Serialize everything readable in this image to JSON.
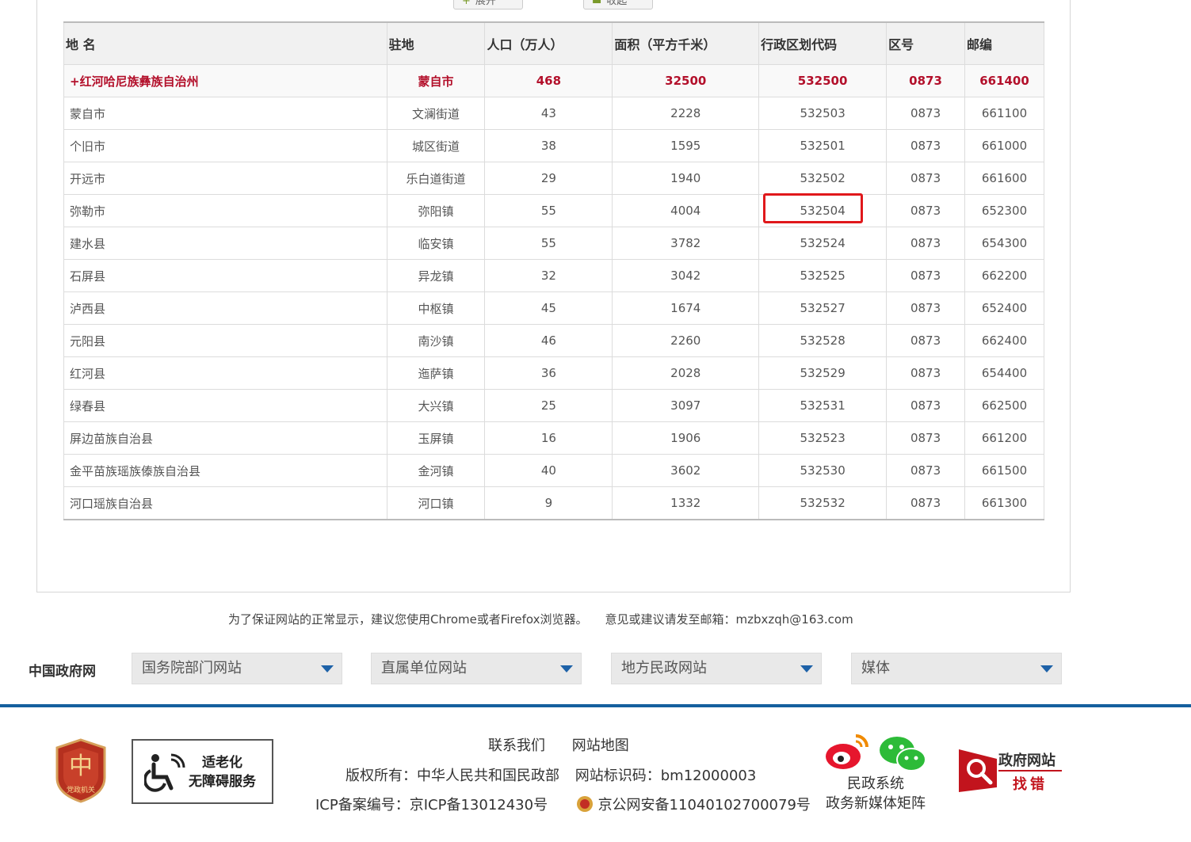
{
  "top_buttons": {
    "expand": "展开",
    "collect": "收起"
  },
  "table": {
    "headers": [
      "地 名",
      "驻地",
      "人口（万人）",
      "面积（平方千米）",
      "行政区划代码",
      "区号",
      "邮编"
    ],
    "rows": [
      {
        "name": "+红河哈尼族彝族自治州",
        "seat": "蒙自市",
        "pop": "468",
        "area": "32500",
        "code": "532500",
        "tel": "0873",
        "zip": "661400"
      },
      {
        "name": "蒙自市",
        "seat": "文澜街道",
        "pop": "43",
        "area": "2228",
        "code": "532503",
        "tel": "0873",
        "zip": "661100"
      },
      {
        "name": "个旧市",
        "seat": "城区街道",
        "pop": "38",
        "area": "1595",
        "code": "532501",
        "tel": "0873",
        "zip": "661000"
      },
      {
        "name": "开远市",
        "seat": "乐白道街道",
        "pop": "29",
        "area": "1940",
        "code": "532502",
        "tel": "0873",
        "zip": "661600"
      },
      {
        "name": "弥勒市",
        "seat": "弥阳镇",
        "pop": "55",
        "area": "4004",
        "code": "532504",
        "tel": "0873",
        "zip": "652300"
      },
      {
        "name": "建水县",
        "seat": "临安镇",
        "pop": "55",
        "area": "3782",
        "code": "532524",
        "tel": "0873",
        "zip": "654300"
      },
      {
        "name": "石屏县",
        "seat": "异龙镇",
        "pop": "32",
        "area": "3042",
        "code": "532525",
        "tel": "0873",
        "zip": "662200"
      },
      {
        "name": "泸西县",
        "seat": "中枢镇",
        "pop": "45",
        "area": "1674",
        "code": "532527",
        "tel": "0873",
        "zip": "652400"
      },
      {
        "name": "元阳县",
        "seat": "南沙镇",
        "pop": "46",
        "area": "2260",
        "code": "532528",
        "tel": "0873",
        "zip": "662400"
      },
      {
        "name": "红河县",
        "seat": "迤萨镇",
        "pop": "36",
        "area": "2028",
        "code": "532529",
        "tel": "0873",
        "zip": "654400"
      },
      {
        "name": "绿春县",
        "seat": "大兴镇",
        "pop": "25",
        "area": "3097",
        "code": "532531",
        "tel": "0873",
        "zip": "662500"
      },
      {
        "name": "屏边苗族自治县",
        "seat": "玉屏镇",
        "pop": "16",
        "area": "1906",
        "code": "532523",
        "tel": "0873",
        "zip": "661200"
      },
      {
        "name": "金平苗族瑶族傣族自治县",
        "seat": "金河镇",
        "pop": "40",
        "area": "3602",
        "code": "532530",
        "tel": "0873",
        "zip": "661500"
      },
      {
        "name": "河口瑶族自治县",
        "seat": "河口镇",
        "pop": "9",
        "area": "1332",
        "code": "532532",
        "tel": "0873",
        "zip": "661300"
      }
    ]
  },
  "notice": {
    "browser": "为了保证网站的正常显示，建议您使用Chrome或者Firefox浏览器。",
    "email": "意见或建议请发至邮箱：mzbxzqh@163.com"
  },
  "govnav": {
    "label": "中国政府网",
    "selects": [
      "国务院部门网站",
      "直属单位网站",
      "地方民政网站",
      "媒体"
    ]
  },
  "footer": {
    "contact": "联系我们",
    "sitemap": "网站地图",
    "copyright": "版权所有：中华人民共和国民政部",
    "site_id": "网站标识码：bm12000003",
    "icp": "ICP备案编号：京ICP备13012430号",
    "police": "京公网安备11040102700079号",
    "badge_text": "党政机关",
    "access_line1": "适老化",
    "access_line2": "无障碍服务",
    "media_line1": "民政系统",
    "media_line2": "政务新媒体矩阵",
    "jiucuo_line1": "政府网站",
    "jiucuo_line2": "找错"
  },
  "colors": {
    "accent_red": "#b3102b",
    "footer_blue": "#15609e",
    "highlight": "#e0181b"
  }
}
